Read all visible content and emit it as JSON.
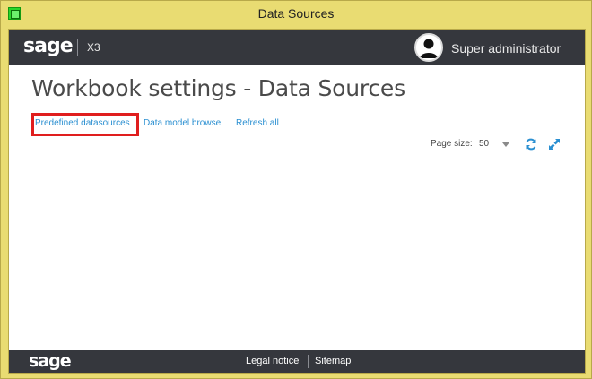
{
  "window": {
    "title": "Data Sources"
  },
  "header": {
    "logo": "sage",
    "module": "X3",
    "user": "Super administrator"
  },
  "page": {
    "title": "Workbook settings - Data Sources"
  },
  "links": {
    "predefined": "Predefined datasources",
    "data_model": "Data model browse",
    "refresh_all": "Refresh all"
  },
  "pager": {
    "label": "Page size:",
    "value": "50"
  },
  "footer": {
    "logo": "sage",
    "legal": "Legal notice",
    "sitemap": "Sitemap"
  },
  "colors": {
    "link": "#2a8fd1",
    "highlight": "#e01e1e",
    "bar": "#35373d",
    "frame": "#e9dc72"
  },
  "icons": [
    "app-icon",
    "avatar",
    "caret-down-icon",
    "refresh-icon",
    "expand-icon"
  ]
}
